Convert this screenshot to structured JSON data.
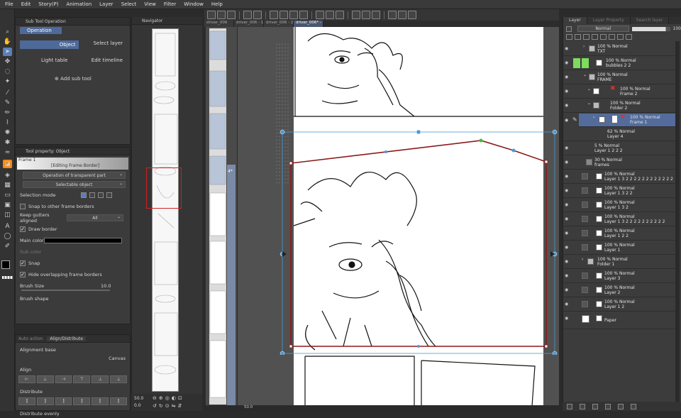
{
  "menu": [
    "File",
    "Edit",
    "Story(P)",
    "Animation",
    "Layer",
    "Select",
    "View",
    "Filter",
    "Window",
    "Help"
  ],
  "sub_tool": {
    "panel_title": "Sub Tool Operation",
    "group_tab": "Operation",
    "options": [
      "Object",
      "Select layer",
      "Light table",
      "Edit timeline"
    ],
    "add_label": "Add sub tool"
  },
  "tool_property": {
    "panel_title": "Tool property: Object",
    "preview_label": "Frame 1",
    "preview_caption": "[Editing Frame Border]",
    "dropdown_1": "Operation of transparent part",
    "dropdown_2": "Selectable object",
    "selection_mode_label": "Selection mode",
    "snap_borders_label": "Snap to other frame borders",
    "keep_gutters_label": "Keep gutters aligned",
    "keep_gutters_value": "All",
    "draw_border_label": "Draw border",
    "main_color_label": "Main color",
    "sub_color_label": "Sub color",
    "snap_label": "Snap",
    "hide_overlap_label": "Hide overlapping frame borders",
    "brush_size_label": "Brush Size",
    "brush_size_value": "10.0",
    "brush_shape_label": "Brush shape"
  },
  "align": {
    "tab_1": "Auto action",
    "tab_2": "Align/Distribute",
    "base_label": "Alignment base",
    "base_value": "Canvas",
    "align_label": "Align",
    "distribute_label": "Distribute",
    "distribute_evenly_label": "Distribute evenly"
  },
  "navigator": {
    "title": "Navigator",
    "zoom_value": "50.0",
    "rotate_value": "0.0"
  },
  "canvas_tabs": [
    "driver_006",
    "driver_006 - 1/8",
    "driver_006 - 2/8",
    "driver_006* - 4/8"
  ],
  "status": {
    "zoom": "50.0"
  },
  "page_strip": {
    "label": "4*"
  },
  "layer_panel": {
    "tabs": [
      "Layer",
      "Layer Property",
      "Search layer"
    ],
    "blend_mode": "Normal",
    "opacity": "100",
    "layers": [
      {
        "pct": "100 % Normal",
        "name": "TXT"
      },
      {
        "pct": "100 % Normal",
        "name": "bubbles 2 2"
      },
      {
        "pct": "100 % Normal",
        "name": "FRAME"
      },
      {
        "pct": "100 % Normal",
        "name": "Frame 2"
      },
      {
        "pct": "100 % Normal",
        "name": "Folder 2"
      },
      {
        "pct": "100 % Normal",
        "name": "Frame 1"
      },
      {
        "pct": "62 % Normal",
        "name": "Layer 4"
      },
      {
        "pct": "5 % Normal",
        "name": "Layer 1 2 2 2"
      },
      {
        "pct": "30 % Normal",
        "name": "frames"
      },
      {
        "pct": "100 % Normal",
        "name": "Layer 1 3 2 2 2 2 2 2 2 2 2 2 2 2"
      },
      {
        "pct": "100 % Normal",
        "name": "Layer 1 3 2 2"
      },
      {
        "pct": "100 % Normal",
        "name": "Layer 1 3 2"
      },
      {
        "pct": "100 % Normal",
        "name": "Layer 1 3 2 2 2 2 2 2 2 2 2 2"
      },
      {
        "pct": "100 % Normal",
        "name": "Layer 1 2 2"
      },
      {
        "pct": "100 % Normal",
        "name": "Layer 1"
      },
      {
        "pct": "100 % Normal",
        "name": "Folder 1"
      },
      {
        "pct": "100 % Normal",
        "name": "Layer 3"
      },
      {
        "pct": "100 % Normal",
        "name": "Layer 2"
      },
      {
        "pct": "100 % Normal",
        "name": "Layer 1 2"
      },
      {
        "pct": "",
        "name": "Paper"
      }
    ]
  },
  "colors": {
    "accent": "#536c9b",
    "frame_border": "#8b1a1a",
    "handle": "#4a9ad8",
    "highlight_green": "#7cdc5c",
    "highlight_purple": "#7a6ee0"
  }
}
